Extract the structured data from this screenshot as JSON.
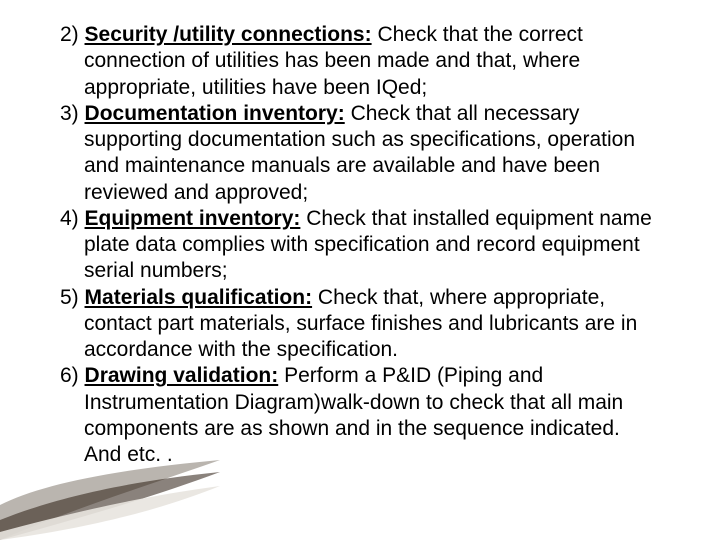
{
  "items": [
    {
      "num": "2)",
      "title": "Security /utility connections:",
      "body": " Check that the correct connection of utilities has been made and that, where appropriate, utilities have been IQed;"
    },
    {
      "num": "3)",
      "title": "Documentation inventory:",
      "body": " Check that all necessary supporting documentation such as specifications, operation and maintenance manuals are available and have been reviewed and approved;"
    },
    {
      "num": "4)",
      "title": "Equipment inventory:",
      "body": " Check that installed equipment name plate data complies with specification and record equipment serial numbers;"
    },
    {
      "num": "5)",
      "title": "Materials qualification:",
      "body": " Check that, where appropriate, contact part materials, surface finishes and lubricants are in accordance with the specification."
    },
    {
      "num": "6)",
      "title": "Drawing validation:",
      "body": " Perform a P&ID (Piping and Instrumentation Diagram)walk-down to check that all main components are as shown and in the sequence indicated.  And etc. ."
    }
  ]
}
